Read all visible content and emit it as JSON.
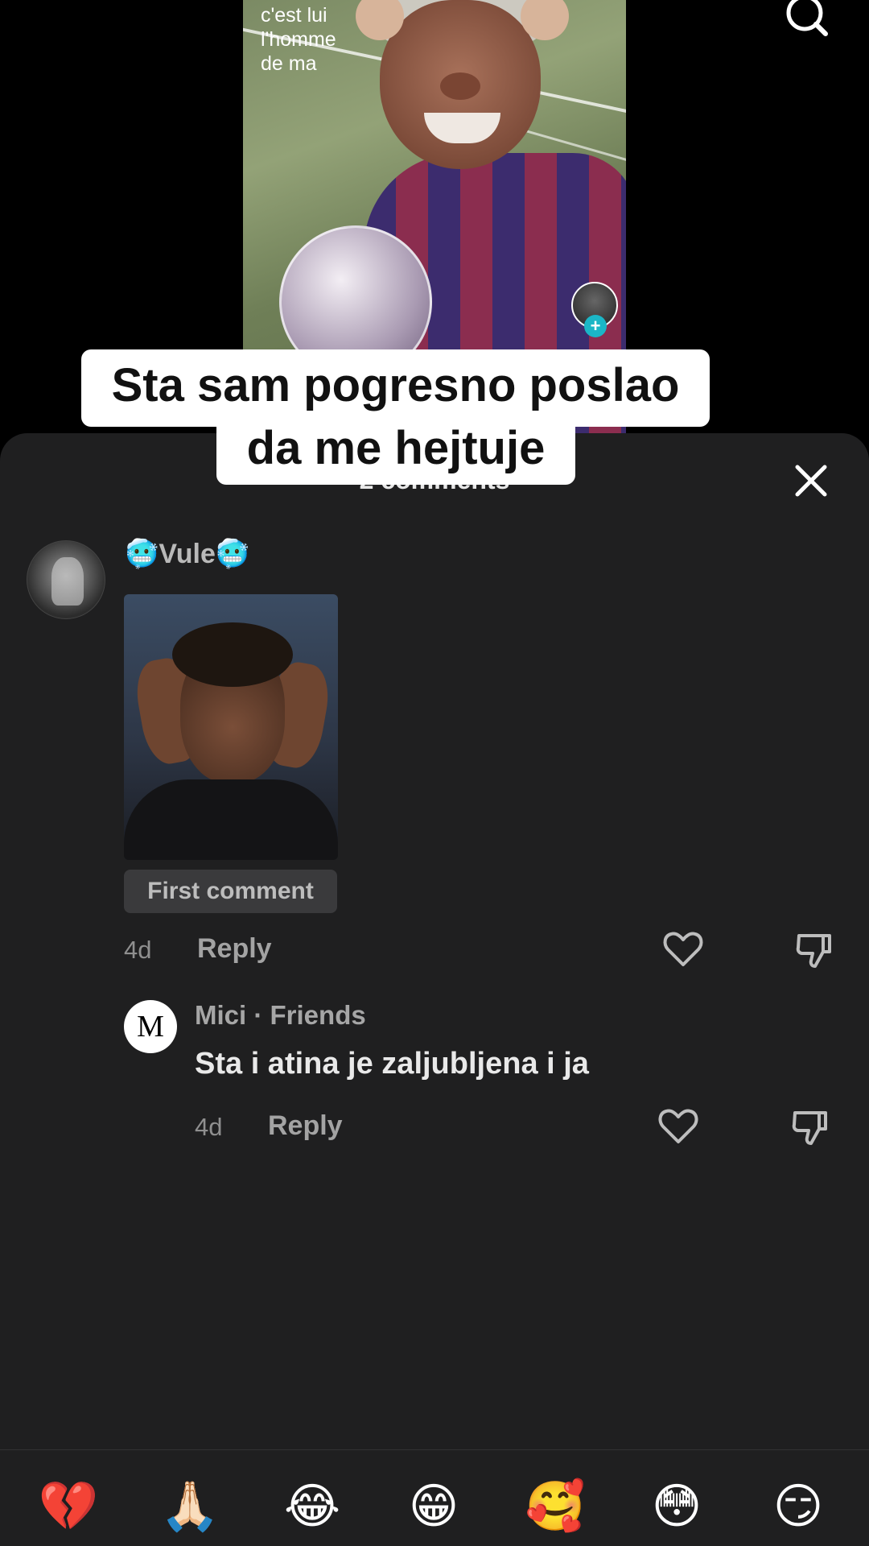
{
  "video": {
    "overlay_text": [
      "c'est   lui",
      "l'homme",
      "de     ma"
    ]
  },
  "caption": {
    "line1": "Sta sam pogresno poslao",
    "line2": "da me hejtuje"
  },
  "sheet": {
    "title": "2 comments"
  },
  "comments": [
    {
      "username": "🥶Vule🥶",
      "badge": "First comment",
      "time": "4d",
      "reply_label": "Reply"
    },
    {
      "avatar_letter": "M",
      "username": "Mici",
      "relation": "· Friends",
      "text": "Sta i atina je zaljubljena i ja",
      "time": "4d",
      "reply_label": "Reply"
    }
  ],
  "emoji_bar": [
    "💔",
    "🙏🏻",
    "😂",
    "😁",
    "🥰",
    "😳",
    "😏"
  ],
  "colors": {
    "sheet_bg": "#1f1f20",
    "follow_accent": "#1bb6c6",
    "caption_bg": "#ffffff"
  }
}
